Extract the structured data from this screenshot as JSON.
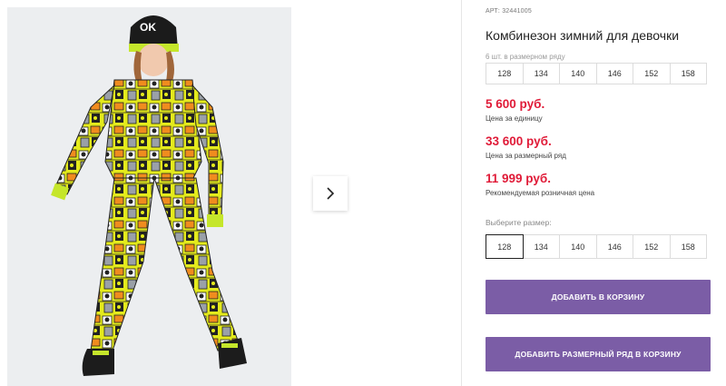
{
  "product": {
    "sku_prefix": "АРТ:",
    "sku": "32441005",
    "title": "Комбинезон зимний для девочки"
  },
  "pack": {
    "label": "6 шт. в размерном ряду",
    "sizes": [
      "128",
      "134",
      "140",
      "146",
      "152",
      "158"
    ]
  },
  "prices": {
    "unit": {
      "value": "5 600 руб.",
      "note": "Цена за единицу"
    },
    "pack": {
      "value": "33 600 руб.",
      "note": "Цена за размерный ряд"
    },
    "retail": {
      "value": "11 999 руб.",
      "note": "Рекомендуемая розничная цена"
    }
  },
  "size_picker": {
    "label": "Выберите размер:",
    "sizes": [
      "128",
      "134",
      "140",
      "146",
      "152",
      "158"
    ],
    "selected": "128"
  },
  "actions": {
    "add_to_cart": "ДОБАВИТЬ В КОРЗИНУ",
    "add_pack_to_cart": "ДОБАВИТЬ РАЗМЕРНЫЙ РЯД В КОРЗИНУ"
  },
  "colors": {
    "price": "#e01b38",
    "button": "#7b5da6",
    "suit_yellow": "#e4ea1c"
  },
  "icons": {
    "next": "chevron-right-icon"
  }
}
